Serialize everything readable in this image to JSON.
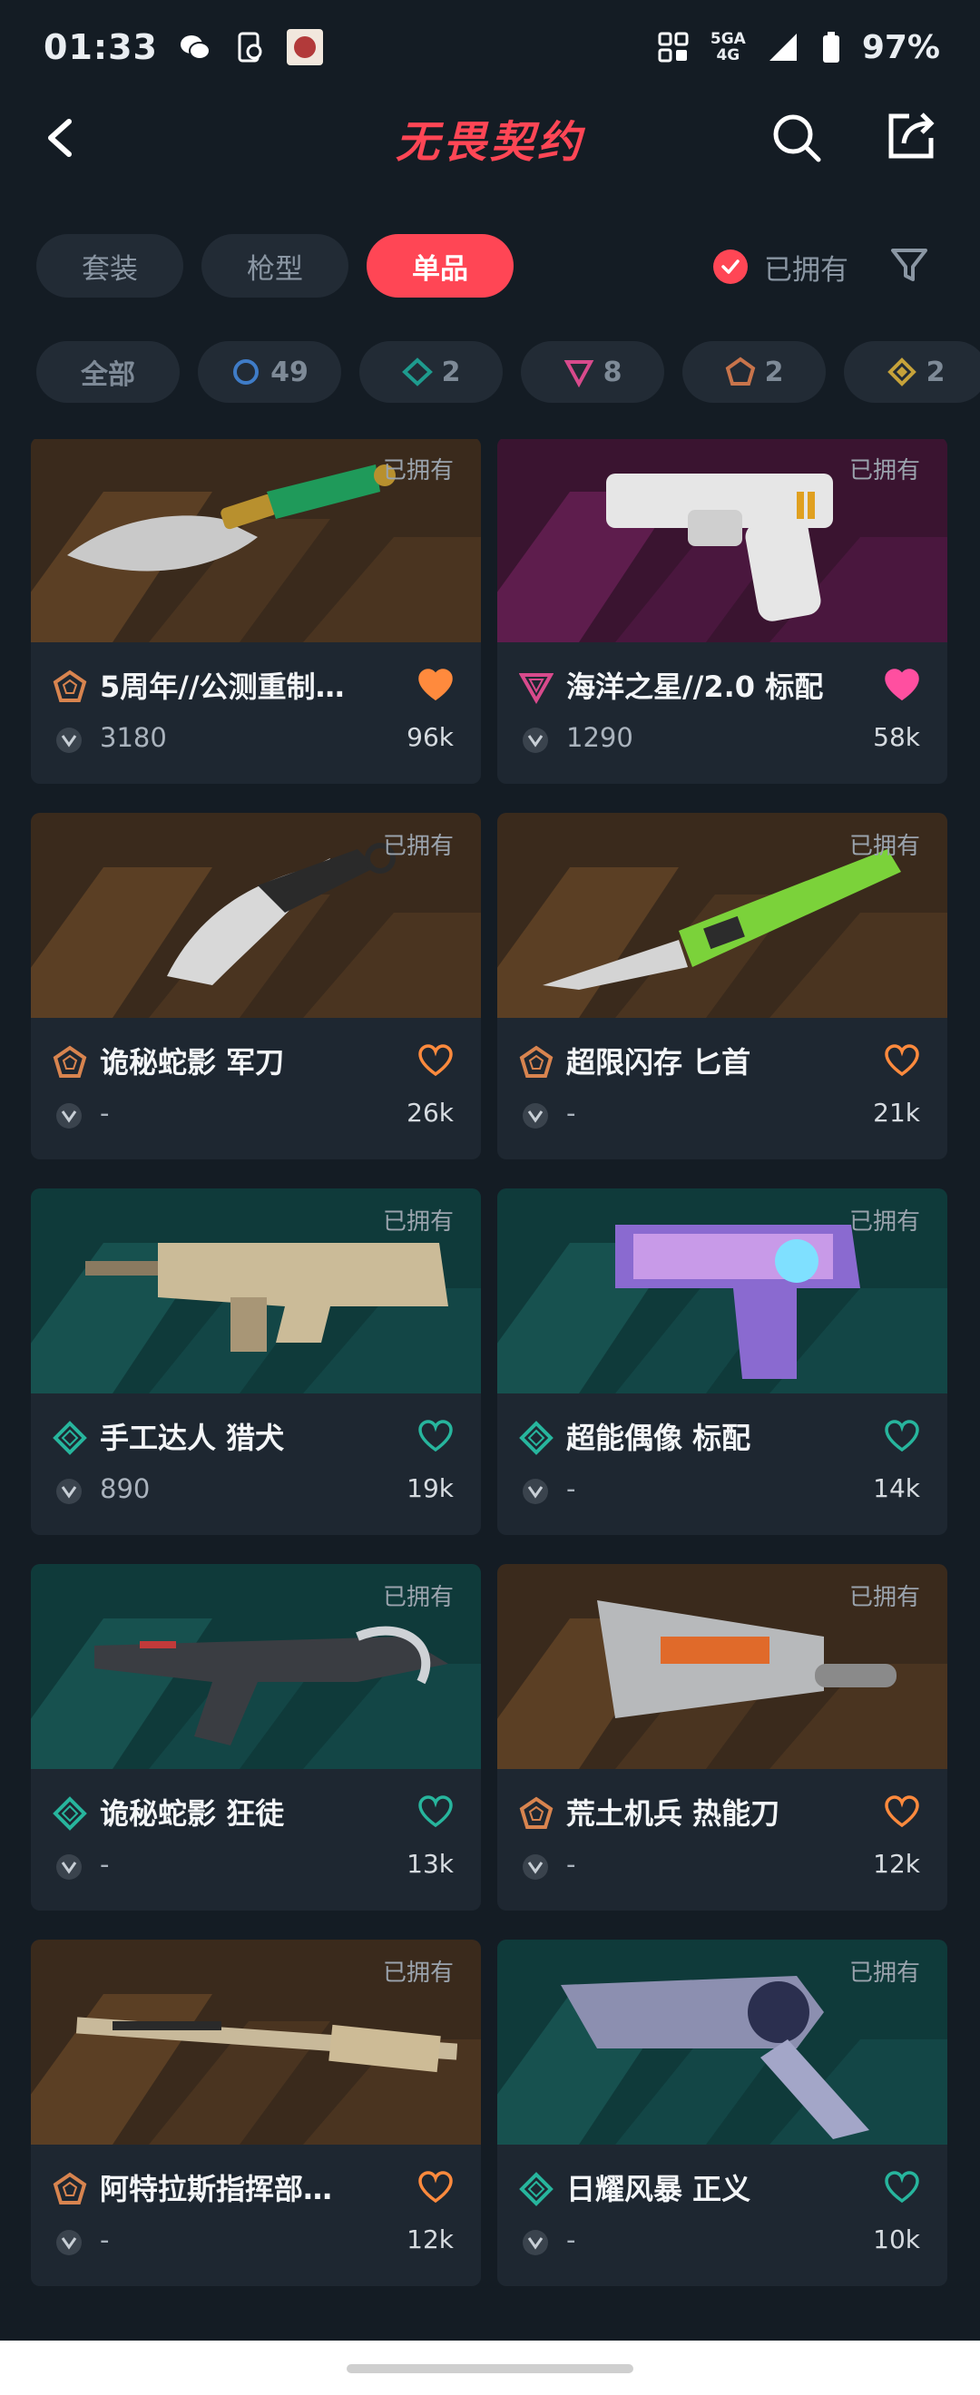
{
  "status_bar": {
    "time": "01:33",
    "network_top": "5GA",
    "network_bottom": "4G",
    "battery": "97%"
  },
  "header": {
    "title": "无畏契约"
  },
  "tabs": [
    {
      "label": "套装",
      "active": false
    },
    {
      "label": "枪型",
      "active": false
    },
    {
      "label": "单品",
      "active": true
    }
  ],
  "owned_filter": {
    "label": "已拥有",
    "checked": true
  },
  "tier_filters": [
    {
      "label": "全部"
    },
    {
      "count": "49",
      "tier": "select",
      "color": "#3f7cc7"
    },
    {
      "count": "2",
      "tier": "deluxe",
      "color": "#1e9b8e"
    },
    {
      "count": "8",
      "tier": "ultra",
      "color": "#d84a8c"
    },
    {
      "count": "2",
      "tier": "premium",
      "color": "#c8744b"
    },
    {
      "count": "2",
      "tier": "exclusive",
      "color": "#c6a23a"
    }
  ],
  "items": [
    {
      "name": "5周年//公测重制…",
      "tier": "premium",
      "price": "3180",
      "likes": "96k",
      "liked": true,
      "heart_color": "#ff8a3d",
      "owned": "已拥有",
      "theme": "brown",
      "weapon": "knife-gold"
    },
    {
      "name": "海洋之星//2.0 标配",
      "tier": "ultra",
      "price": "1290",
      "likes": "58k",
      "liked": true,
      "heart_color": "#ff4fa0",
      "owned": "已拥有",
      "theme": "magenta",
      "weapon": "pistol-white"
    },
    {
      "name": "诡秘蛇影 军刀",
      "tier": "premium",
      "price": "-",
      "likes": "26k",
      "liked": false,
      "heart_color": "#ff8a3d",
      "owned": "已拥有",
      "theme": "brown",
      "weapon": "karambit"
    },
    {
      "name": "超限闪存 匕首",
      "tier": "premium",
      "price": "-",
      "likes": "21k",
      "liked": false,
      "heart_color": "#ff8a3d",
      "owned": "已拥有",
      "theme": "brown",
      "weapon": "knife-green"
    },
    {
      "name": "手工达人 猎犬",
      "tier": "deluxe",
      "price": "890",
      "likes": "19k",
      "liked": false,
      "heart_color": "#27b59d",
      "owned": "已拥有",
      "theme": "teal",
      "weapon": "rifle-tan"
    },
    {
      "name": "超能偶像 标配",
      "tier": "deluxe",
      "price": "-",
      "likes": "14k",
      "liked": false,
      "heart_color": "#27b59d",
      "owned": "已拥有",
      "theme": "teal",
      "weapon": "pistol-anime"
    },
    {
      "name": "诡秘蛇影 狂徒",
      "tier": "deluxe",
      "price": "-",
      "likes": "13k",
      "liked": false,
      "heart_color": "#27b59d",
      "owned": "已拥有",
      "theme": "teal",
      "weapon": "rifle-dark"
    },
    {
      "name": "荒土机兵 热能刀",
      "tier": "premium",
      "price": "-",
      "likes": "12k",
      "liked": false,
      "heart_color": "#ff8a3d",
      "owned": "已拥有",
      "theme": "brown",
      "weapon": "cleaver"
    },
    {
      "name": "阿特拉斯指挥部…",
      "tier": "premium",
      "price": "-",
      "likes": "12k",
      "liked": false,
      "heart_color": "#ff8a3d",
      "owned": "已拥有",
      "theme": "brown",
      "weapon": "sniper"
    },
    {
      "name": "日耀风暴 正义",
      "tier": "deluxe",
      "price": "-",
      "likes": "10k",
      "liked": false,
      "heart_color": "#27b59d",
      "owned": "已拥有",
      "theme": "teal",
      "weapon": "revolver"
    }
  ],
  "colors": {
    "accent": "#ff4655",
    "background": "#141c24",
    "card": "#1e2731"
  }
}
